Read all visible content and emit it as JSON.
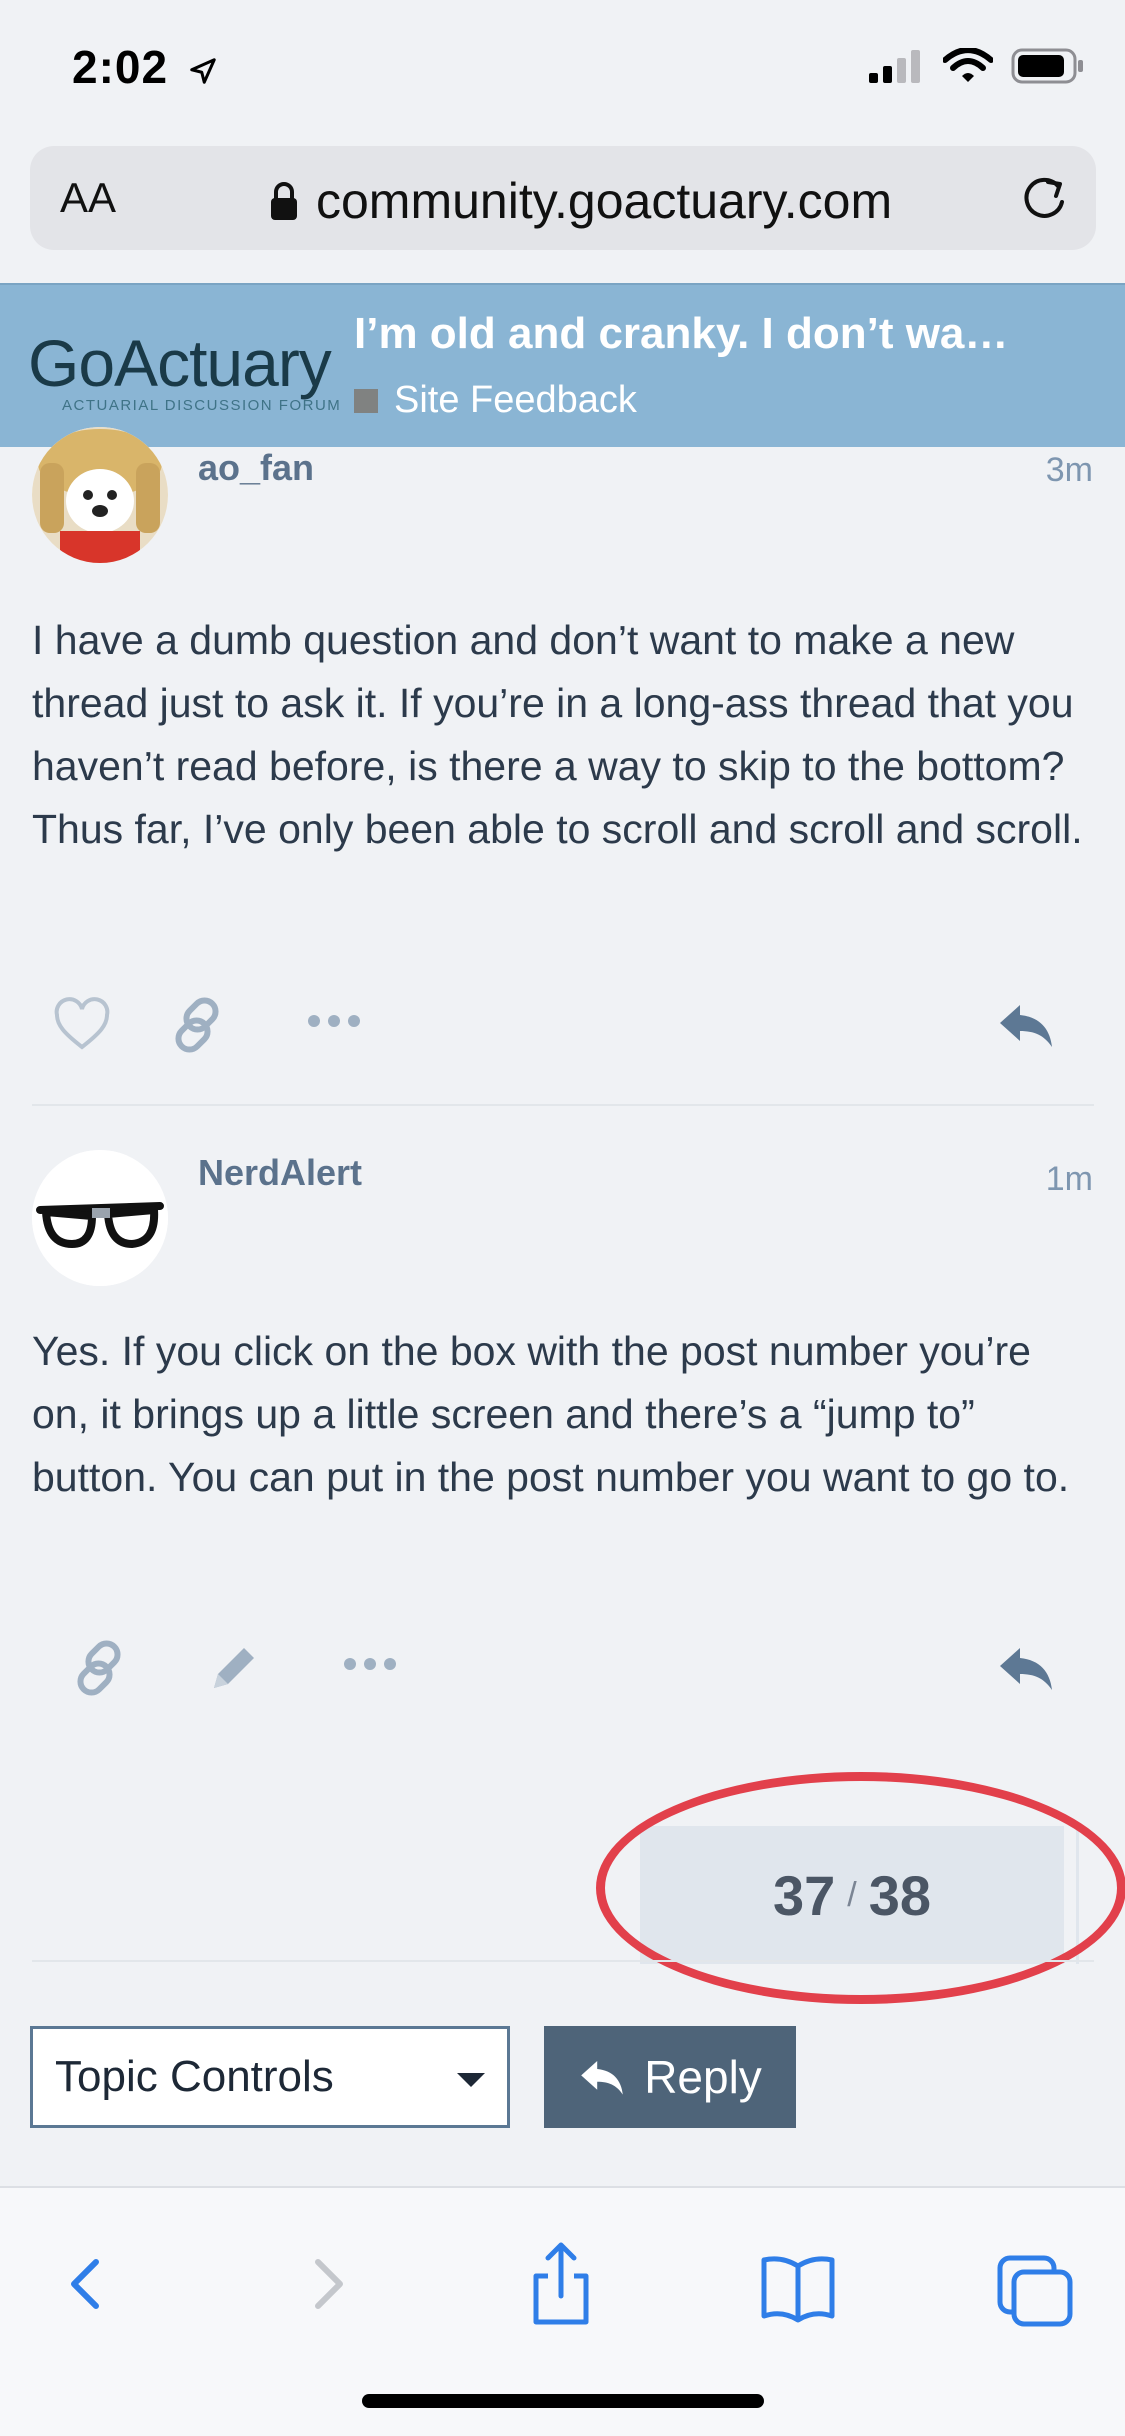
{
  "status_bar": {
    "time": "2:02",
    "icons": [
      "location-arrow-icon",
      "cellular-signal-icon",
      "wifi-icon",
      "battery-icon"
    ]
  },
  "browser": {
    "text_size_label": "AA",
    "url": "community.goactuary.com",
    "icons": [
      "lock-icon",
      "reload-icon"
    ]
  },
  "site_header": {
    "logo_text": "GoActuary",
    "logo_tagline": "ACTUARIAL DISCUSSION FORUM",
    "topic_title": "I’m old and cranky. I don’t wa…",
    "category": "Site Feedback",
    "category_color": "#808281",
    "background": "#8ab5d4"
  },
  "posts": [
    {
      "username": "ao_fan",
      "time": "3m",
      "body": "I have a dumb question and don’t want to make a new thread just to ask it. If you’re in a long-ass thread that you haven’t read before, is there a way to skip to the bottom? Thus far, I’ve only been able to scroll and scroll and scroll.",
      "actions": [
        "heart-icon",
        "link-icon",
        "more-icon",
        "reply-icon"
      ]
    },
    {
      "username": "NerdAlert",
      "time": "1m",
      "body": "Yes. If you click on the box with the post number you’re on, it brings up a little screen and there’s a “jump to” button. You can put in the post number you want to go to.",
      "actions": [
        "link-icon",
        "pencil-icon",
        "more-icon",
        "reply-icon"
      ]
    }
  ],
  "progress": {
    "current": "37",
    "separator": "/",
    "total": "38",
    "highlight_color": "#e2404b"
  },
  "controls": {
    "topic_controls_label": "Topic Controls",
    "reply_label": "Reply"
  },
  "toolbar": {
    "icons": [
      "back-icon",
      "forward-icon",
      "share-icon",
      "bookmarks-icon",
      "tabs-icon"
    ],
    "accent": "#2f7ee8"
  }
}
